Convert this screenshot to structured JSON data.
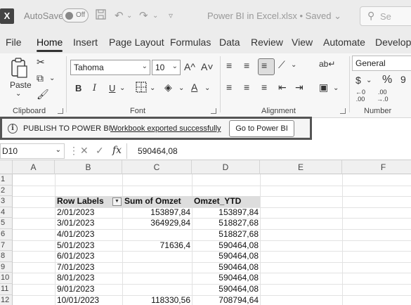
{
  "titlebar": {
    "logo": "X",
    "autosave_label": "AutoSave",
    "toggle_state": "Off",
    "filename": "Power BI in Excel.xlsx • Saved",
    "filename_chevron": "⌄",
    "search_placeholder": "Se",
    "icons": [
      "save-icon",
      "undo-icon",
      "redo-icon"
    ]
  },
  "menu": {
    "tabs": [
      "File",
      "Home",
      "Insert",
      "Page Layout",
      "Formulas",
      "Data",
      "Review",
      "View",
      "Automate",
      "Develope"
    ],
    "active": "Home"
  },
  "ribbon": {
    "clipboard": {
      "label": "Clipboard",
      "paste_label": "Paste"
    },
    "font": {
      "label": "Font",
      "font_name": "Tahoma",
      "font_size": "10",
      "bold": "B",
      "italic": "I",
      "underline": "U",
      "grow": "A^",
      "shrink": "A˅"
    },
    "alignment": {
      "label": "Alignment"
    },
    "number": {
      "label": "Number",
      "format": "General",
      "currency": "$",
      "percent": "%"
    }
  },
  "infobar": {
    "title": "PUBLISH TO POWER BI",
    "message": "Workbook exported successfully",
    "button": "Go to Power BI"
  },
  "formula_bar": {
    "name_box": "D10",
    "fx": "fx",
    "value": "590464,08"
  },
  "grid": {
    "columns": [
      "A",
      "B",
      "C",
      "D",
      "E",
      "F"
    ],
    "rows": [
      "1",
      "2",
      "3",
      "4",
      "5",
      "6",
      "7",
      "8",
      "9",
      "10",
      "11",
      "12"
    ],
    "pivot": {
      "headers": [
        "Row Labels",
        "Sum of Omzet",
        "Omzet_YTD"
      ],
      "data": [
        [
          "2/01/2023",
          "153897,84",
          "153897,84"
        ],
        [
          "3/01/2023",
          "364929,84",
          "518827,68"
        ],
        [
          "4/01/2023",
          "",
          "518827,68"
        ],
        [
          "5/01/2023",
          "71636,4",
          "590464,08"
        ],
        [
          "6/01/2023",
          "",
          "590464,08"
        ],
        [
          "7/01/2023",
          "",
          "590464,08"
        ],
        [
          "8/01/2023",
          "",
          "590464,08"
        ],
        [
          "9/01/2023",
          "",
          "590464,08"
        ],
        [
          "10/01/2023",
          "118330,56",
          "708794,64"
        ]
      ]
    }
  }
}
